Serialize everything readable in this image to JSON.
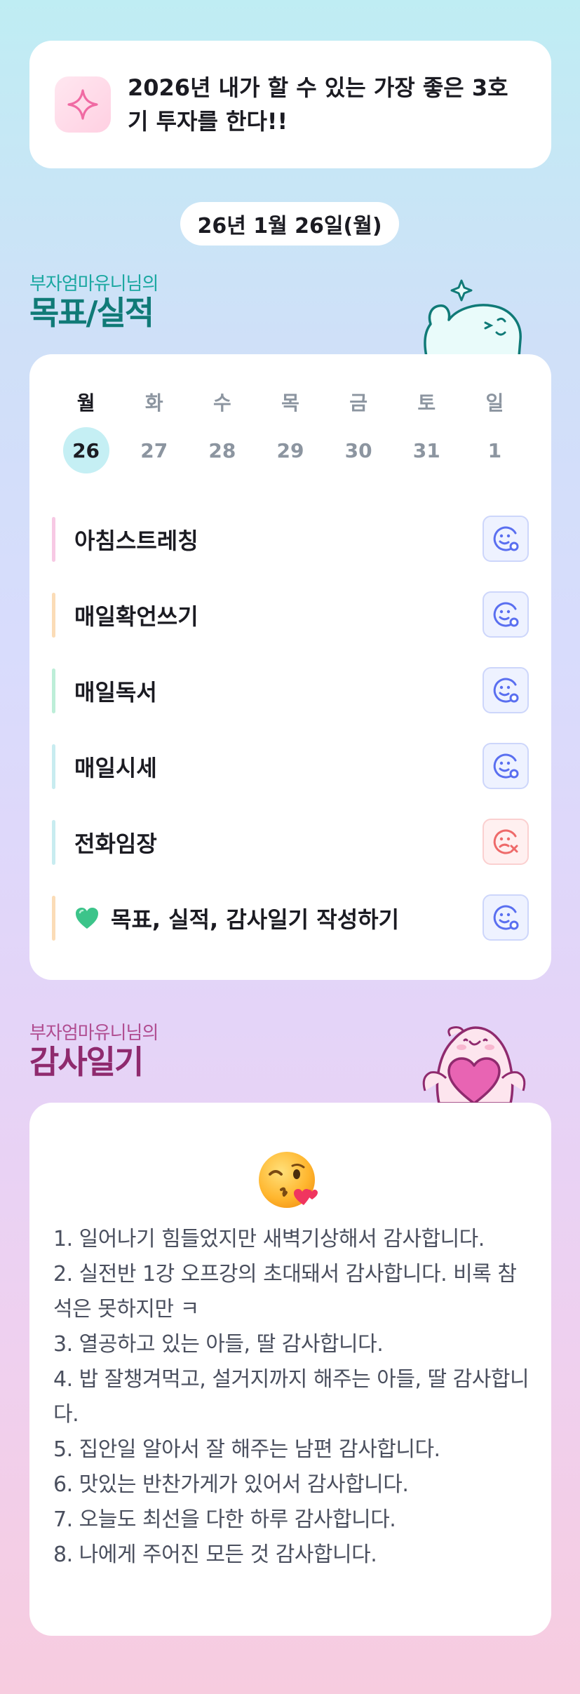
{
  "goal": {
    "icon": "sparkle-icon",
    "text": "2026년 내가 할 수 있는 가장 좋은 3호기 투자를 한다!!"
  },
  "date_label": "26년 1월 26일(월)",
  "goals_section": {
    "subtitle": "부자엄마유니님의",
    "title": "목표/실적"
  },
  "week": {
    "days": [
      {
        "name": "월",
        "num": "26",
        "active": true
      },
      {
        "name": "화",
        "num": "27",
        "active": false
      },
      {
        "name": "수",
        "num": "28",
        "active": false
      },
      {
        "name": "목",
        "num": "29",
        "active": false
      },
      {
        "name": "금",
        "num": "30",
        "active": false
      },
      {
        "name": "토",
        "num": "31",
        "active": false
      },
      {
        "name": "일",
        "num": "1",
        "active": false
      }
    ]
  },
  "tasks": [
    {
      "label": "아침스트레칭",
      "bar_color": "#f7c9e4",
      "status": "done",
      "status_icon": "smile-check-icon"
    },
    {
      "label": "매일확언쓰기",
      "bar_color": "#fbdcb7",
      "status": "done",
      "status_icon": "smile-check-icon"
    },
    {
      "label": "매일독서",
      "bar_color": "#bdeed8",
      "status": "done",
      "status_icon": "smile-check-icon"
    },
    {
      "label": "매일시세",
      "bar_color": "#c8ecf0",
      "status": "done",
      "status_icon": "smile-check-icon"
    },
    {
      "label": "전화임장",
      "bar_color": "#c8ecf0",
      "status": "missed",
      "status_icon": "sad-x-icon"
    },
    {
      "label": "목표, 실적, 감사일기 작성하기",
      "bar_color": "#fbdcb7",
      "status": "done",
      "status_icon": "smile-check-icon",
      "prefix_icon": "green-heart-icon"
    }
  ],
  "thanks_section": {
    "subtitle": "부자엄마유니님의",
    "title": "감사일기",
    "emoji": "face-blowing-kiss-emoji",
    "lines": [
      "1. 일어나기 힘들었지만 새벽기상해서 감사합니다.",
      "2. 실전반 1강 오프강의 초대돼서 감사합니다. 비록 참석은 못하지만 ㅋ",
      "3. 열공하고 있는 아들, 딸 감사합니다.",
      "4. 밥 잘챙겨먹고, 설거지까지 해주는 아들, 딸 감사합니다.",
      "5. 집안일 알아서 잘 해주는 남편 감사합니다.",
      "6. 맛있는 반찬가게가 있어서 감사합니다.",
      "7. 오늘도 최선을 다한 하루 감사합니다.",
      "8. 나에게 주어진 모든 것 감사합니다."
    ]
  },
  "colors": {
    "done_icon": "#5a6ff0",
    "missed_icon": "#ee6a6a",
    "goal_title": "#107a77",
    "thanks_title": "#8f2a6e"
  }
}
